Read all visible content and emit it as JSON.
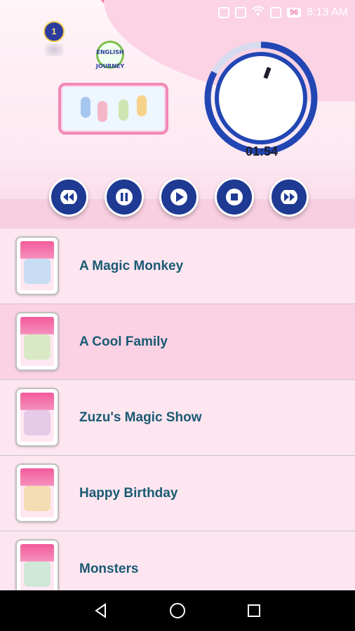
{
  "status_bar": {
    "battery": "96",
    "time": "8:13 AM"
  },
  "header": {
    "level_badge": "1",
    "logo_line1": "ENGLISH",
    "logo_line2": "JOURNEY"
  },
  "player": {
    "elapsed_time": "01:54",
    "progress_fraction": 0.83,
    "controls": [
      {
        "name": "rewind",
        "icon": "rewind-icon"
      },
      {
        "name": "pause",
        "icon": "pause-icon"
      },
      {
        "name": "play",
        "icon": "play-icon"
      },
      {
        "name": "stop",
        "icon": "stop-icon"
      },
      {
        "name": "fast-forward",
        "icon": "fast-forward-icon"
      }
    ]
  },
  "stories": [
    {
      "title": "A Magic Monkey",
      "highlighted": false
    },
    {
      "title": "A Cool Family",
      "highlighted": true
    },
    {
      "title": "Zuzu's Magic Show",
      "highlighted": false
    },
    {
      "title": "Happy Birthday",
      "highlighted": false
    },
    {
      "title": "Monsters",
      "highlighted": false
    }
  ],
  "navigation": {
    "buttons": [
      "back-icon",
      "home-icon",
      "recents-icon"
    ]
  },
  "colors": {
    "accent": "#1f3a93",
    "title_text": "#1a5a73",
    "pink": "#ef7fb0"
  }
}
